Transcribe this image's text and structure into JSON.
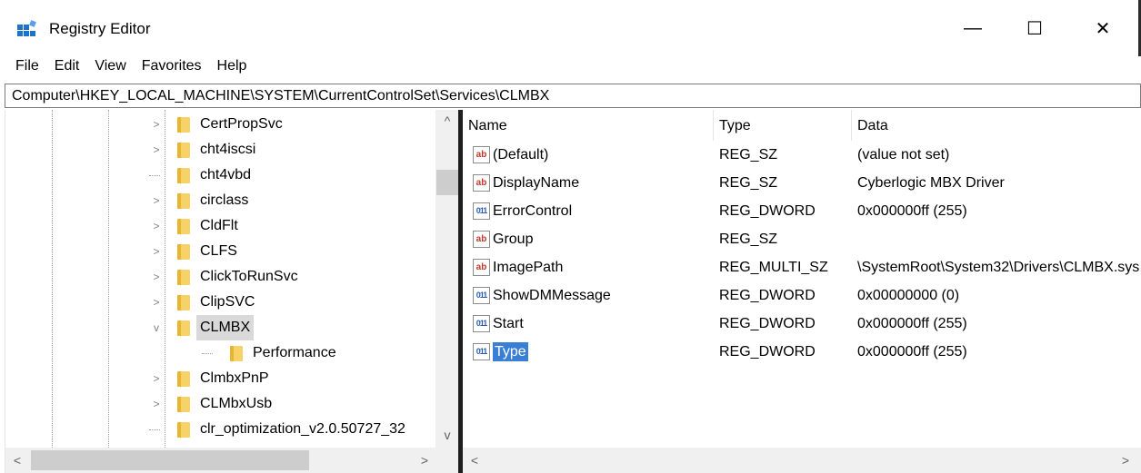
{
  "window": {
    "title": "Registry Editor",
    "minimize_glyph": "—",
    "maximize_glyph": "☐",
    "close_glyph": "✕"
  },
  "menu": [
    "File",
    "Edit",
    "View",
    "Favorites",
    "Help"
  ],
  "address": "Computer\\HKEY_LOCAL_MACHINE\\SYSTEM\\CurrentControlSet\\Services\\CLMBX",
  "tree": {
    "items": [
      {
        "label": "CertPropSvc",
        "expander": ">",
        "selected": false
      },
      {
        "label": "cht4iscsi",
        "expander": ">",
        "selected": false
      },
      {
        "label": "cht4vbd",
        "expander": "",
        "selected": false
      },
      {
        "label": "circlass",
        "expander": ">",
        "selected": false
      },
      {
        "label": "CldFlt",
        "expander": ">",
        "selected": false
      },
      {
        "label": "CLFS",
        "expander": ">",
        "selected": false
      },
      {
        "label": "ClickToRunSvc",
        "expander": ">",
        "selected": false
      },
      {
        "label": "ClipSVC",
        "expander": ">",
        "selected": false
      },
      {
        "label": "CLMBX",
        "expander": "v",
        "selected": true
      },
      {
        "label": "Performance",
        "expander": "",
        "selected": false,
        "child": true
      },
      {
        "label": "ClmbxPnP",
        "expander": ">",
        "selected": false
      },
      {
        "label": "CLMbxUsb",
        "expander": ">",
        "selected": false
      },
      {
        "label": "clr_optimization_v2.0.50727_32",
        "expander": "",
        "selected": false
      }
    ]
  },
  "values": {
    "columns": [
      "Name",
      "Type",
      "Data"
    ],
    "rows": [
      {
        "name": "(Default)",
        "type": "REG_SZ",
        "data": "(value not set)",
        "icon": "string-value-icon",
        "icon_text": "ab"
      },
      {
        "name": "DisplayName",
        "type": "REG_SZ",
        "data": "Cyberlogic MBX Driver",
        "icon": "string-value-icon",
        "icon_text": "ab"
      },
      {
        "name": "ErrorControl",
        "type": "REG_DWORD",
        "data": "0x000000ff (255)",
        "icon": "binary-value-icon",
        "icon_text": "011"
      },
      {
        "name": "Group",
        "type": "REG_SZ",
        "data": "",
        "icon": "string-value-icon",
        "icon_text": "ab"
      },
      {
        "name": "ImagePath",
        "type": "REG_MULTI_SZ",
        "data": "\\SystemRoot\\System32\\Drivers\\CLMBX.sys",
        "icon": "string-value-icon",
        "icon_text": "ab"
      },
      {
        "name": "ShowDMMessage",
        "type": "REG_DWORD",
        "data": "0x00000000 (0)",
        "icon": "binary-value-icon",
        "icon_text": "011"
      },
      {
        "name": "Start",
        "type": "REG_DWORD",
        "data": "0x000000ff (255)",
        "icon": "binary-value-icon",
        "icon_text": "011"
      },
      {
        "name": "Type",
        "type": "REG_DWORD",
        "data": "0x000000ff (255)",
        "icon": "binary-value-icon",
        "icon_text": "011",
        "selected": true
      }
    ]
  },
  "scroll": {
    "up": "^",
    "down": "v",
    "left": "<",
    "right": ">"
  }
}
